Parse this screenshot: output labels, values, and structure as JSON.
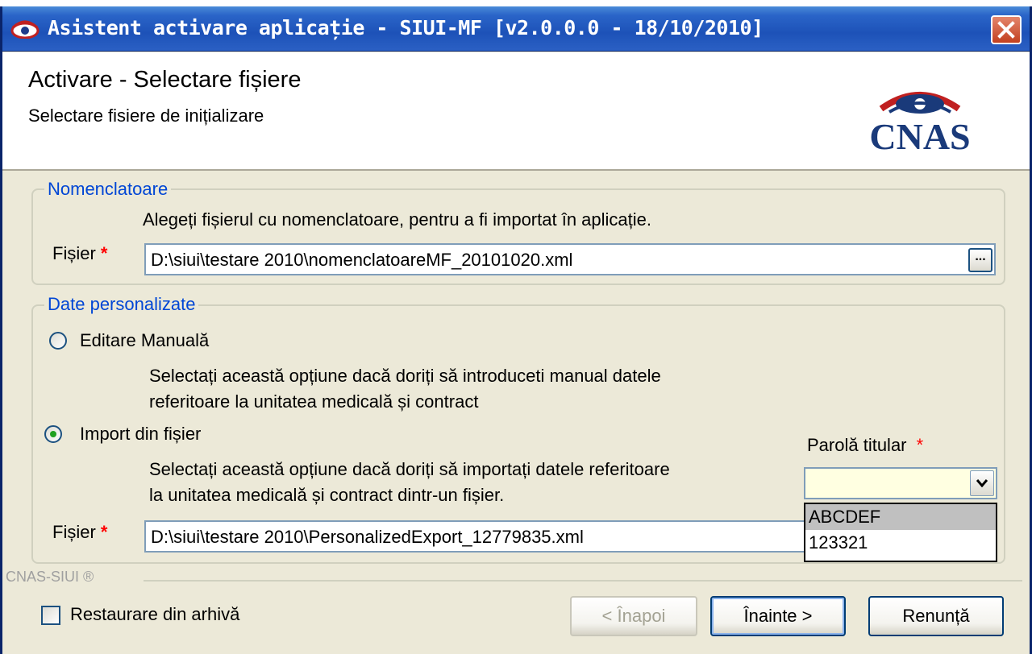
{
  "window": {
    "title": "Asistent activare aplicație - SIUI-MF [v2.0.0.0 - 18/10/2010]"
  },
  "header": {
    "title": "Activare - Selectare fișiere",
    "subtitle": "Selectare fisiere de inițializare",
    "logo_text": "CNAS"
  },
  "nomenclatoare": {
    "legend": "Nomenclatoare",
    "description": "Alegeți fișierul cu nomenclatoare, pentru a fi importat în aplicație.",
    "file_label": "Fișier",
    "required_mark": "*",
    "file_value": "D:\\siui\\testare 2010\\nomenclatoareMF_20101020.xml",
    "browse_label": "..."
  },
  "personalizate": {
    "legend": "Date personalizate",
    "option_manual": "Editare Manuală",
    "manual_desc_line1": "Selectați această opțiune dacă doriți să introduceti manual datele",
    "manual_desc_line2": "referitoare la unitatea medicală și contract",
    "option_import": "Import din fișier",
    "import_desc_line1": "Selectați această opțiune dacă doriți să importați datele referitoare",
    "import_desc_line2": "la unitatea medicală și contract dintr-un fișier.",
    "file_label": "Fișier",
    "required_mark": "*",
    "file_value": "D:\\siui\\testare 2010\\PersonalizedExport_12779835.xml",
    "selected_option": "import"
  },
  "parola": {
    "label": "Parolă titular",
    "required_mark": "*",
    "value": "",
    "options": [
      "ABCDEF",
      "123321"
    ],
    "highlighted": "ABCDEF"
  },
  "footer": {
    "brand": "CNAS-SIUI ®",
    "restore_label": "Restaurare din arhivă",
    "restore_checked": false,
    "back_label_prefix": "< Î",
    "back_label": "< Înapoi",
    "next_label": "Înainte >",
    "cancel_label": "Renunță"
  },
  "colors": {
    "titlebar": "#1d52b8",
    "legend_text": "#0046d5",
    "required": "#ff0000",
    "logo": "#1a3a7a",
    "combo_bg": "#ffffe1"
  }
}
